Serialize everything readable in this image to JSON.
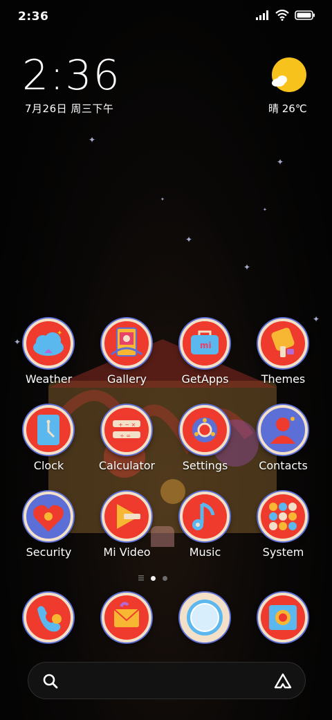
{
  "status_bar": {
    "time": "2:36"
  },
  "widget": {
    "time": "2:36",
    "date": "7月26日 周三下午",
    "weather": "晴 26℃",
    "weather_icon": "sunny-partly-cloudy-icon"
  },
  "apps": [
    {
      "label": "Weather",
      "icon": "weather-icon"
    },
    {
      "label": "Gallery",
      "icon": "gallery-icon"
    },
    {
      "label": "GetApps",
      "icon": "getapps-icon"
    },
    {
      "label": "Themes",
      "icon": "themes-icon"
    },
    {
      "label": "Clock",
      "icon": "clock-icon"
    },
    {
      "label": "Calculator",
      "icon": "calculator-icon"
    },
    {
      "label": "Settings",
      "icon": "settings-icon"
    },
    {
      "label": "Contacts",
      "icon": "contacts-icon"
    },
    {
      "label": "Security",
      "icon": "security-icon"
    },
    {
      "label": "Mi Video",
      "icon": "mi-video-icon"
    },
    {
      "label": "Music",
      "icon": "music-icon"
    },
    {
      "label": "System",
      "icon": "system-folder-icon"
    }
  ],
  "page_indicator": {
    "pages": 2,
    "current": 1
  },
  "dock": [
    {
      "icon": "phone-icon"
    },
    {
      "icon": "messages-icon"
    },
    {
      "icon": "browser-icon"
    },
    {
      "icon": "camera-icon"
    }
  ],
  "search": {
    "icon": "search-icon",
    "assistant_icon": "assistant-icon"
  },
  "colors": {
    "icon_red": "#ee3b2e",
    "icon_rim": "#f3e0c8",
    "icon_blue": "#5b6fd6",
    "accent_yellow": "#f7c21c"
  }
}
